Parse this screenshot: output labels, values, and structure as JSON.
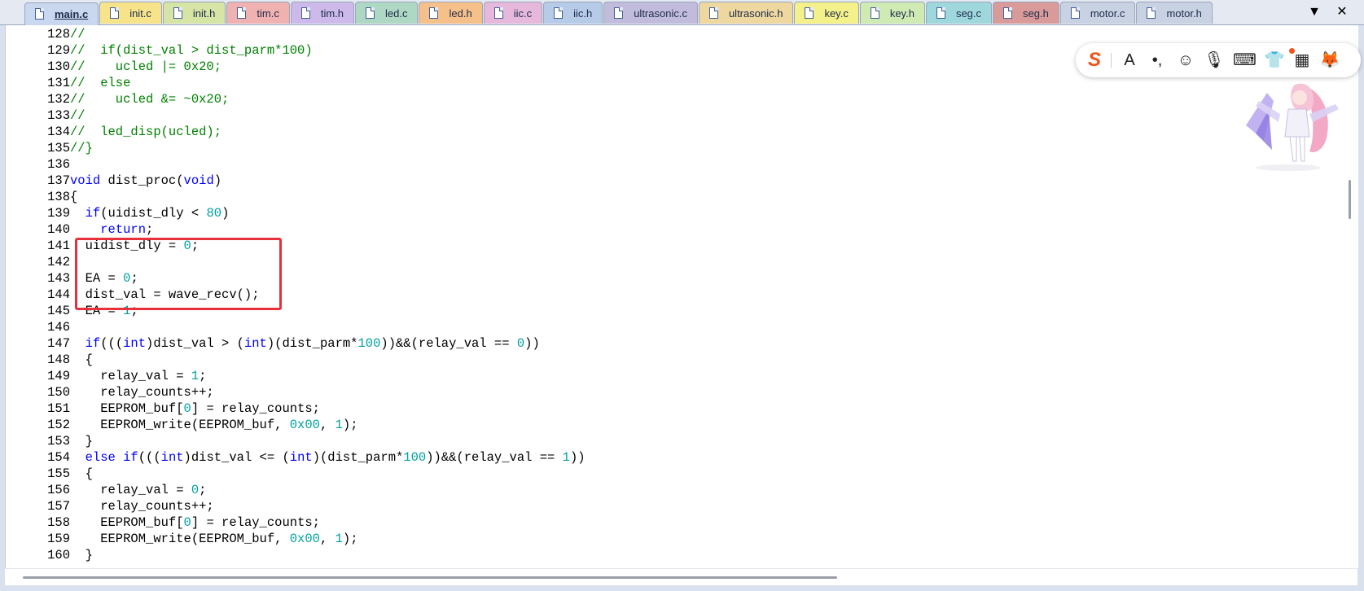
{
  "tabs": [
    {
      "label": "main.c",
      "color": "#c9d7ef",
      "active": true
    },
    {
      "label": "init.c",
      "color": "#f7e48a"
    },
    {
      "label": "init.h",
      "color": "#d6e4a6"
    },
    {
      "label": "tim.c",
      "color": "#f0b1b1"
    },
    {
      "label": "tim.h",
      "color": "#cdb9ea"
    },
    {
      "label": "led.c",
      "color": "#aed8c3"
    },
    {
      "label": "led.h",
      "color": "#f6c08a"
    },
    {
      "label": "iic.c",
      "color": "#e6b8dc"
    },
    {
      "label": "iic.h",
      "color": "#b6cbe8"
    },
    {
      "label": "ultrasonic.c",
      "color": "#c2bcdc"
    },
    {
      "label": "ultrasonic.h",
      "color": "#eed8a0"
    },
    {
      "label": "key.c",
      "color": "#f4f08a"
    },
    {
      "label": "key.h",
      "color": "#cfeab2"
    },
    {
      "label": "seg.c",
      "color": "#9ed8dc"
    },
    {
      "label": "seg.h",
      "color": "#d99a9a"
    },
    {
      "label": "motor.c",
      "color": "#c8d2e2"
    },
    {
      "label": "motor.h",
      "color": "#c8d2e2"
    }
  ],
  "tab_menu": {
    "dropdown": "▼",
    "close": "✕"
  },
  "lines": [
    {
      "n": "128",
      "tokens": [
        {
          "t": "//",
          "c": "comment"
        }
      ]
    },
    {
      "n": "129",
      "tokens": [
        {
          "t": "//  if(dist_val > dist_parm*100)",
          "c": "comment"
        }
      ]
    },
    {
      "n": "130",
      "tokens": [
        {
          "t": "//    ucled |= 0x20;",
          "c": "comment"
        }
      ]
    },
    {
      "n": "131",
      "tokens": [
        {
          "t": "//  else",
          "c": "comment"
        }
      ]
    },
    {
      "n": "132",
      "tokens": [
        {
          "t": "//    ucled &= ~0x20;",
          "c": "comment"
        }
      ]
    },
    {
      "n": "133",
      "tokens": [
        {
          "t": "//",
          "c": "comment"
        }
      ]
    },
    {
      "n": "134",
      "tokens": [
        {
          "t": "//  led_disp(ucled);",
          "c": "comment"
        }
      ]
    },
    {
      "n": "135",
      "tokens": [
        {
          "t": "//}",
          "c": "comment"
        }
      ]
    },
    {
      "n": "136",
      "tokens": []
    },
    {
      "n": "137",
      "tokens": [
        {
          "t": "void",
          "c": "keyword"
        },
        {
          "t": " dist_proc(",
          "c": "text"
        },
        {
          "t": "void",
          "c": "keyword"
        },
        {
          "t": ")",
          "c": "text"
        }
      ]
    },
    {
      "n": "138",
      "tokens": [
        {
          "t": "{",
          "c": "text"
        }
      ]
    },
    {
      "n": "139",
      "tokens": [
        {
          "t": "  ",
          "c": "text"
        },
        {
          "t": "if",
          "c": "keyword"
        },
        {
          "t": "(uidist_dly < ",
          "c": "text"
        },
        {
          "t": "80",
          "c": "number"
        },
        {
          "t": ")",
          "c": "text"
        }
      ]
    },
    {
      "n": "140",
      "tokens": [
        {
          "t": "    ",
          "c": "text"
        },
        {
          "t": "return",
          "c": "keyword"
        },
        {
          "t": ";",
          "c": "text"
        }
      ]
    },
    {
      "n": "141",
      "tokens": [
        {
          "t": "  uidist_dly = ",
          "c": "text"
        },
        {
          "t": "0",
          "c": "number"
        },
        {
          "t": ";",
          "c": "text"
        }
      ]
    },
    {
      "n": "142",
      "tokens": []
    },
    {
      "n": "143",
      "tokens": [
        {
          "t": "  EA = ",
          "c": "text"
        },
        {
          "t": "0",
          "c": "number"
        },
        {
          "t": ";",
          "c": "text"
        }
      ]
    },
    {
      "n": "144",
      "tokens": [
        {
          "t": "  dist_val = wave_recv();",
          "c": "text"
        }
      ]
    },
    {
      "n": "145",
      "tokens": [
        {
          "t": "  EA = ",
          "c": "text"
        },
        {
          "t": "1",
          "c": "number"
        },
        {
          "t": ";",
          "c": "text"
        }
      ]
    },
    {
      "n": "146",
      "tokens": []
    },
    {
      "n": "147",
      "tokens": [
        {
          "t": "  ",
          "c": "text"
        },
        {
          "t": "if",
          "c": "keyword"
        },
        {
          "t": "(((",
          "c": "text"
        },
        {
          "t": "int",
          "c": "keyword"
        },
        {
          "t": ")dist_val > (",
          "c": "text"
        },
        {
          "t": "int",
          "c": "keyword"
        },
        {
          "t": ")(dist_parm*",
          "c": "text"
        },
        {
          "t": "100",
          "c": "number"
        },
        {
          "t": "))&&(relay_val == ",
          "c": "text"
        },
        {
          "t": "0",
          "c": "number"
        },
        {
          "t": "))",
          "c": "text"
        }
      ]
    },
    {
      "n": "148",
      "tokens": [
        {
          "t": "  {",
          "c": "text"
        }
      ]
    },
    {
      "n": "149",
      "tokens": [
        {
          "t": "    relay_val = ",
          "c": "text"
        },
        {
          "t": "1",
          "c": "number"
        },
        {
          "t": ";",
          "c": "text"
        }
      ]
    },
    {
      "n": "150",
      "tokens": [
        {
          "t": "    relay_counts++;",
          "c": "text"
        }
      ]
    },
    {
      "n": "151",
      "tokens": [
        {
          "t": "    EEPROM_buf[",
          "c": "text"
        },
        {
          "t": "0",
          "c": "number"
        },
        {
          "t": "] = relay_counts;",
          "c": "text"
        }
      ]
    },
    {
      "n": "152",
      "tokens": [
        {
          "t": "    EEPROM_write(EEPROM_buf, ",
          "c": "text"
        },
        {
          "t": "0x00",
          "c": "number"
        },
        {
          "t": ", ",
          "c": "text"
        },
        {
          "t": "1",
          "c": "number"
        },
        {
          "t": ");",
          "c": "text"
        }
      ]
    },
    {
      "n": "153",
      "tokens": [
        {
          "t": "  }",
          "c": "text"
        }
      ]
    },
    {
      "n": "154",
      "tokens": [
        {
          "t": "  ",
          "c": "text"
        },
        {
          "t": "else if",
          "c": "keyword"
        },
        {
          "t": "(((",
          "c": "text"
        },
        {
          "t": "int",
          "c": "keyword"
        },
        {
          "t": ")dist_val <= (",
          "c": "text"
        },
        {
          "t": "int",
          "c": "keyword"
        },
        {
          "t": ")(dist_parm*",
          "c": "text"
        },
        {
          "t": "100",
          "c": "number"
        },
        {
          "t": "))&&(relay_val == ",
          "c": "text"
        },
        {
          "t": "1",
          "c": "number"
        },
        {
          "t": "))",
          "c": "text"
        }
      ]
    },
    {
      "n": "155",
      "tokens": [
        {
          "t": "  {",
          "c": "text"
        }
      ]
    },
    {
      "n": "156",
      "tokens": [
        {
          "t": "    relay_val = ",
          "c": "text"
        },
        {
          "t": "0",
          "c": "number"
        },
        {
          "t": ";",
          "c": "text"
        }
      ]
    },
    {
      "n": "157",
      "tokens": [
        {
          "t": "    relay_counts++;",
          "c": "text"
        }
      ]
    },
    {
      "n": "158",
      "tokens": [
        {
          "t": "    EEPROM_buf[",
          "c": "text"
        },
        {
          "t": "0",
          "c": "number"
        },
        {
          "t": "] = relay_counts;",
          "c": "text"
        }
      ]
    },
    {
      "n": "159",
      "tokens": [
        {
          "t": "    EEPROM_write(EEPROM_buf, ",
          "c": "text"
        },
        {
          "t": "0x00",
          "c": "number"
        },
        {
          "t": ", ",
          "c": "text"
        },
        {
          "t": "1",
          "c": "number"
        },
        {
          "t": ");",
          "c": "text"
        }
      ]
    },
    {
      "n": "160",
      "tokens": [
        {
          "t": "  }",
          "c": "text"
        }
      ]
    }
  ],
  "colors": {
    "comment": "#008000",
    "keyword": "#0000ff",
    "number": "#00a0a0",
    "highlight_box": "#e8303a",
    "ime_brand": "#f0541e"
  },
  "ime_toolbar": {
    "logo": "S",
    "buttons": [
      {
        "name": "font-icon",
        "glyph": "A"
      },
      {
        "name": "punctuation-icon",
        "glyph": "•,"
      },
      {
        "name": "emoji-icon",
        "glyph": "☺"
      },
      {
        "name": "microphone-icon",
        "glyph": "🎙"
      },
      {
        "name": "keyboard-icon",
        "glyph": "⌨"
      },
      {
        "name": "skin-shirt-icon",
        "glyph": "👕"
      },
      {
        "name": "grid-apps-icon",
        "glyph": "▦"
      },
      {
        "name": "mascot-mini-icon",
        "glyph": "🦊"
      }
    ]
  }
}
